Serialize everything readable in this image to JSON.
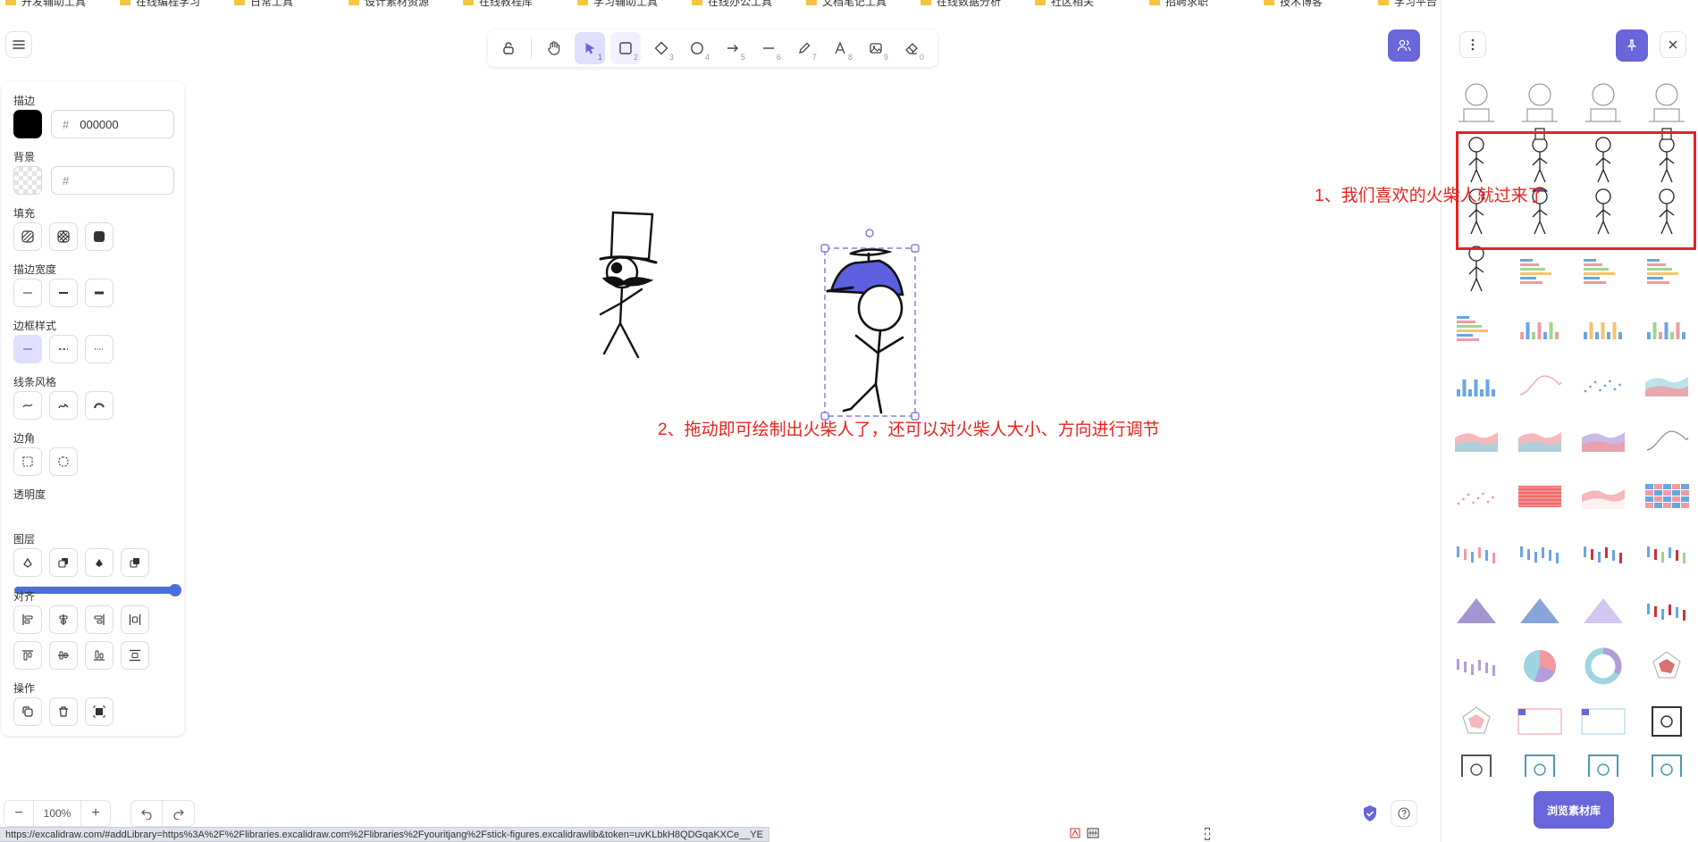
{
  "bookmarks": [
    "开发辅助工具",
    "在线编程学习",
    "日常工具",
    "设计素材资源",
    "在线教程库",
    "学习辅助工具",
    "在线办公工具",
    "文档笔记工具",
    "在线数据分析",
    "社区相关",
    "招聘求职",
    "技术博客",
    "学习平台"
  ],
  "toolbar": {
    "tools": [
      {
        "name": "lock",
        "num": ""
      },
      {
        "name": "hand",
        "num": ""
      },
      {
        "name": "selection",
        "num": "1"
      },
      {
        "name": "rectangle",
        "num": "2"
      },
      {
        "name": "diamond",
        "num": "3"
      },
      {
        "name": "ellipse",
        "num": "4"
      },
      {
        "name": "arrow",
        "num": "5"
      },
      {
        "name": "line",
        "num": "6"
      },
      {
        "name": "draw",
        "num": "7"
      },
      {
        "name": "text",
        "num": "8"
      },
      {
        "name": "image",
        "num": "9"
      },
      {
        "name": "eraser",
        "num": "0"
      }
    ]
  },
  "panel": {
    "stroke_label": "描边",
    "stroke_color": "#000000",
    "stroke_hex": "000000",
    "background_label": "背景",
    "background_hex": "",
    "fill_label": "填充",
    "stroke_width_label": "描边宽度",
    "stroke_style_label": "边框样式",
    "sloppiness_label": "线条风格",
    "edges_label": "边角",
    "opacity_label": "透明度",
    "opacity_value": 100,
    "layers_label": "图层",
    "align_label": "对齐",
    "actions_label": "操作"
  },
  "zoom": {
    "value": "100%",
    "minus": "−",
    "plus": "+"
  },
  "status_url": "https://excalidraw.com/#addLibrary=https%3A%2F%2Flibraries.excalidraw.com%2Flibraries%2Fyouritjang%2Fstick-figures.excalidrawlib&token=uvKLbkH8QDGqaKXCe__YE",
  "annotations": {
    "one": "1、我们喜欢的火柴人就过来了",
    "two": "2、拖动即可绘制出火柴人了，还可以对火柴人大小、方向进行调节"
  },
  "library": {
    "browse_label": "浏览素材库"
  },
  "colors": {
    "accent": "#6965db",
    "annotation_red": "#e8231f",
    "hat_blue": "#5b5fe0"
  }
}
